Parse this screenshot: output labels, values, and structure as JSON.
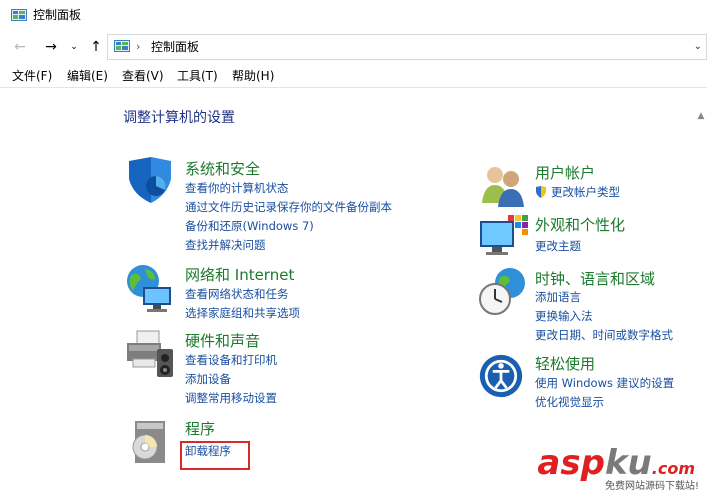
{
  "window": {
    "title": "控制面板"
  },
  "address": {
    "separator": "›",
    "path": "控制面板",
    "back_icon": "←",
    "forward_icon": "→",
    "recent_icon": "⌄",
    "up_icon": "↑",
    "expand_icon": "⌄"
  },
  "menu": [
    "文件(F)",
    "编辑(E)",
    "查看(V)",
    "工具(T)",
    "帮助(H)"
  ],
  "heading": "调整计算机的设置",
  "categories": [
    {
      "id": "system-security",
      "icon": "shield-icon",
      "title": "系统和安全",
      "links": [
        "查看你的计算机状态",
        "通过文件历史记录保存你的文件备份副本",
        "备份和还原(Windows 7)",
        "查找并解决问题"
      ]
    },
    {
      "id": "network-internet",
      "icon": "network-globe-icon",
      "title": "网络和 Internet",
      "links": [
        "查看网络状态和任务",
        "选择家庭组和共享选项"
      ]
    },
    {
      "id": "hardware-sound",
      "icon": "printer-icon",
      "title": "硬件和声音",
      "links": [
        "查看设备和打印机",
        "添加设备",
        "调整常用移动设置"
      ]
    },
    {
      "id": "programs",
      "icon": "programs-disc-icon",
      "title": "程序",
      "links": [
        "卸载程序"
      ]
    },
    {
      "id": "user-accounts",
      "icon": "users-icon",
      "title": "用户帐户",
      "links": [
        "更改帐户类型"
      ]
    },
    {
      "id": "appearance",
      "icon": "monitor-palette-icon",
      "title": "外观和个性化",
      "links": [
        "更改主题"
      ]
    },
    {
      "id": "clock-region",
      "icon": "clock-globe-icon",
      "title": "时钟、语言和区域",
      "links": [
        "添加语言",
        "更换输入法",
        "更改日期、时间或数字格式"
      ]
    },
    {
      "id": "ease-of-access",
      "icon": "ease-of-access-icon",
      "title": "轻松使用",
      "links": [
        "使用 Windows 建议的设置",
        "优化视觉显示"
      ]
    }
  ],
  "watermark": {
    "brand_a": "asp",
    "brand_b": "ku",
    "brand_c": ".com",
    "tagline": "免费网站源码下载站!"
  },
  "colors": {
    "category_title": "#1b7a2b",
    "link": "#1a4fa0",
    "heading": "#1e3287",
    "highlight": "#d62b2b"
  }
}
